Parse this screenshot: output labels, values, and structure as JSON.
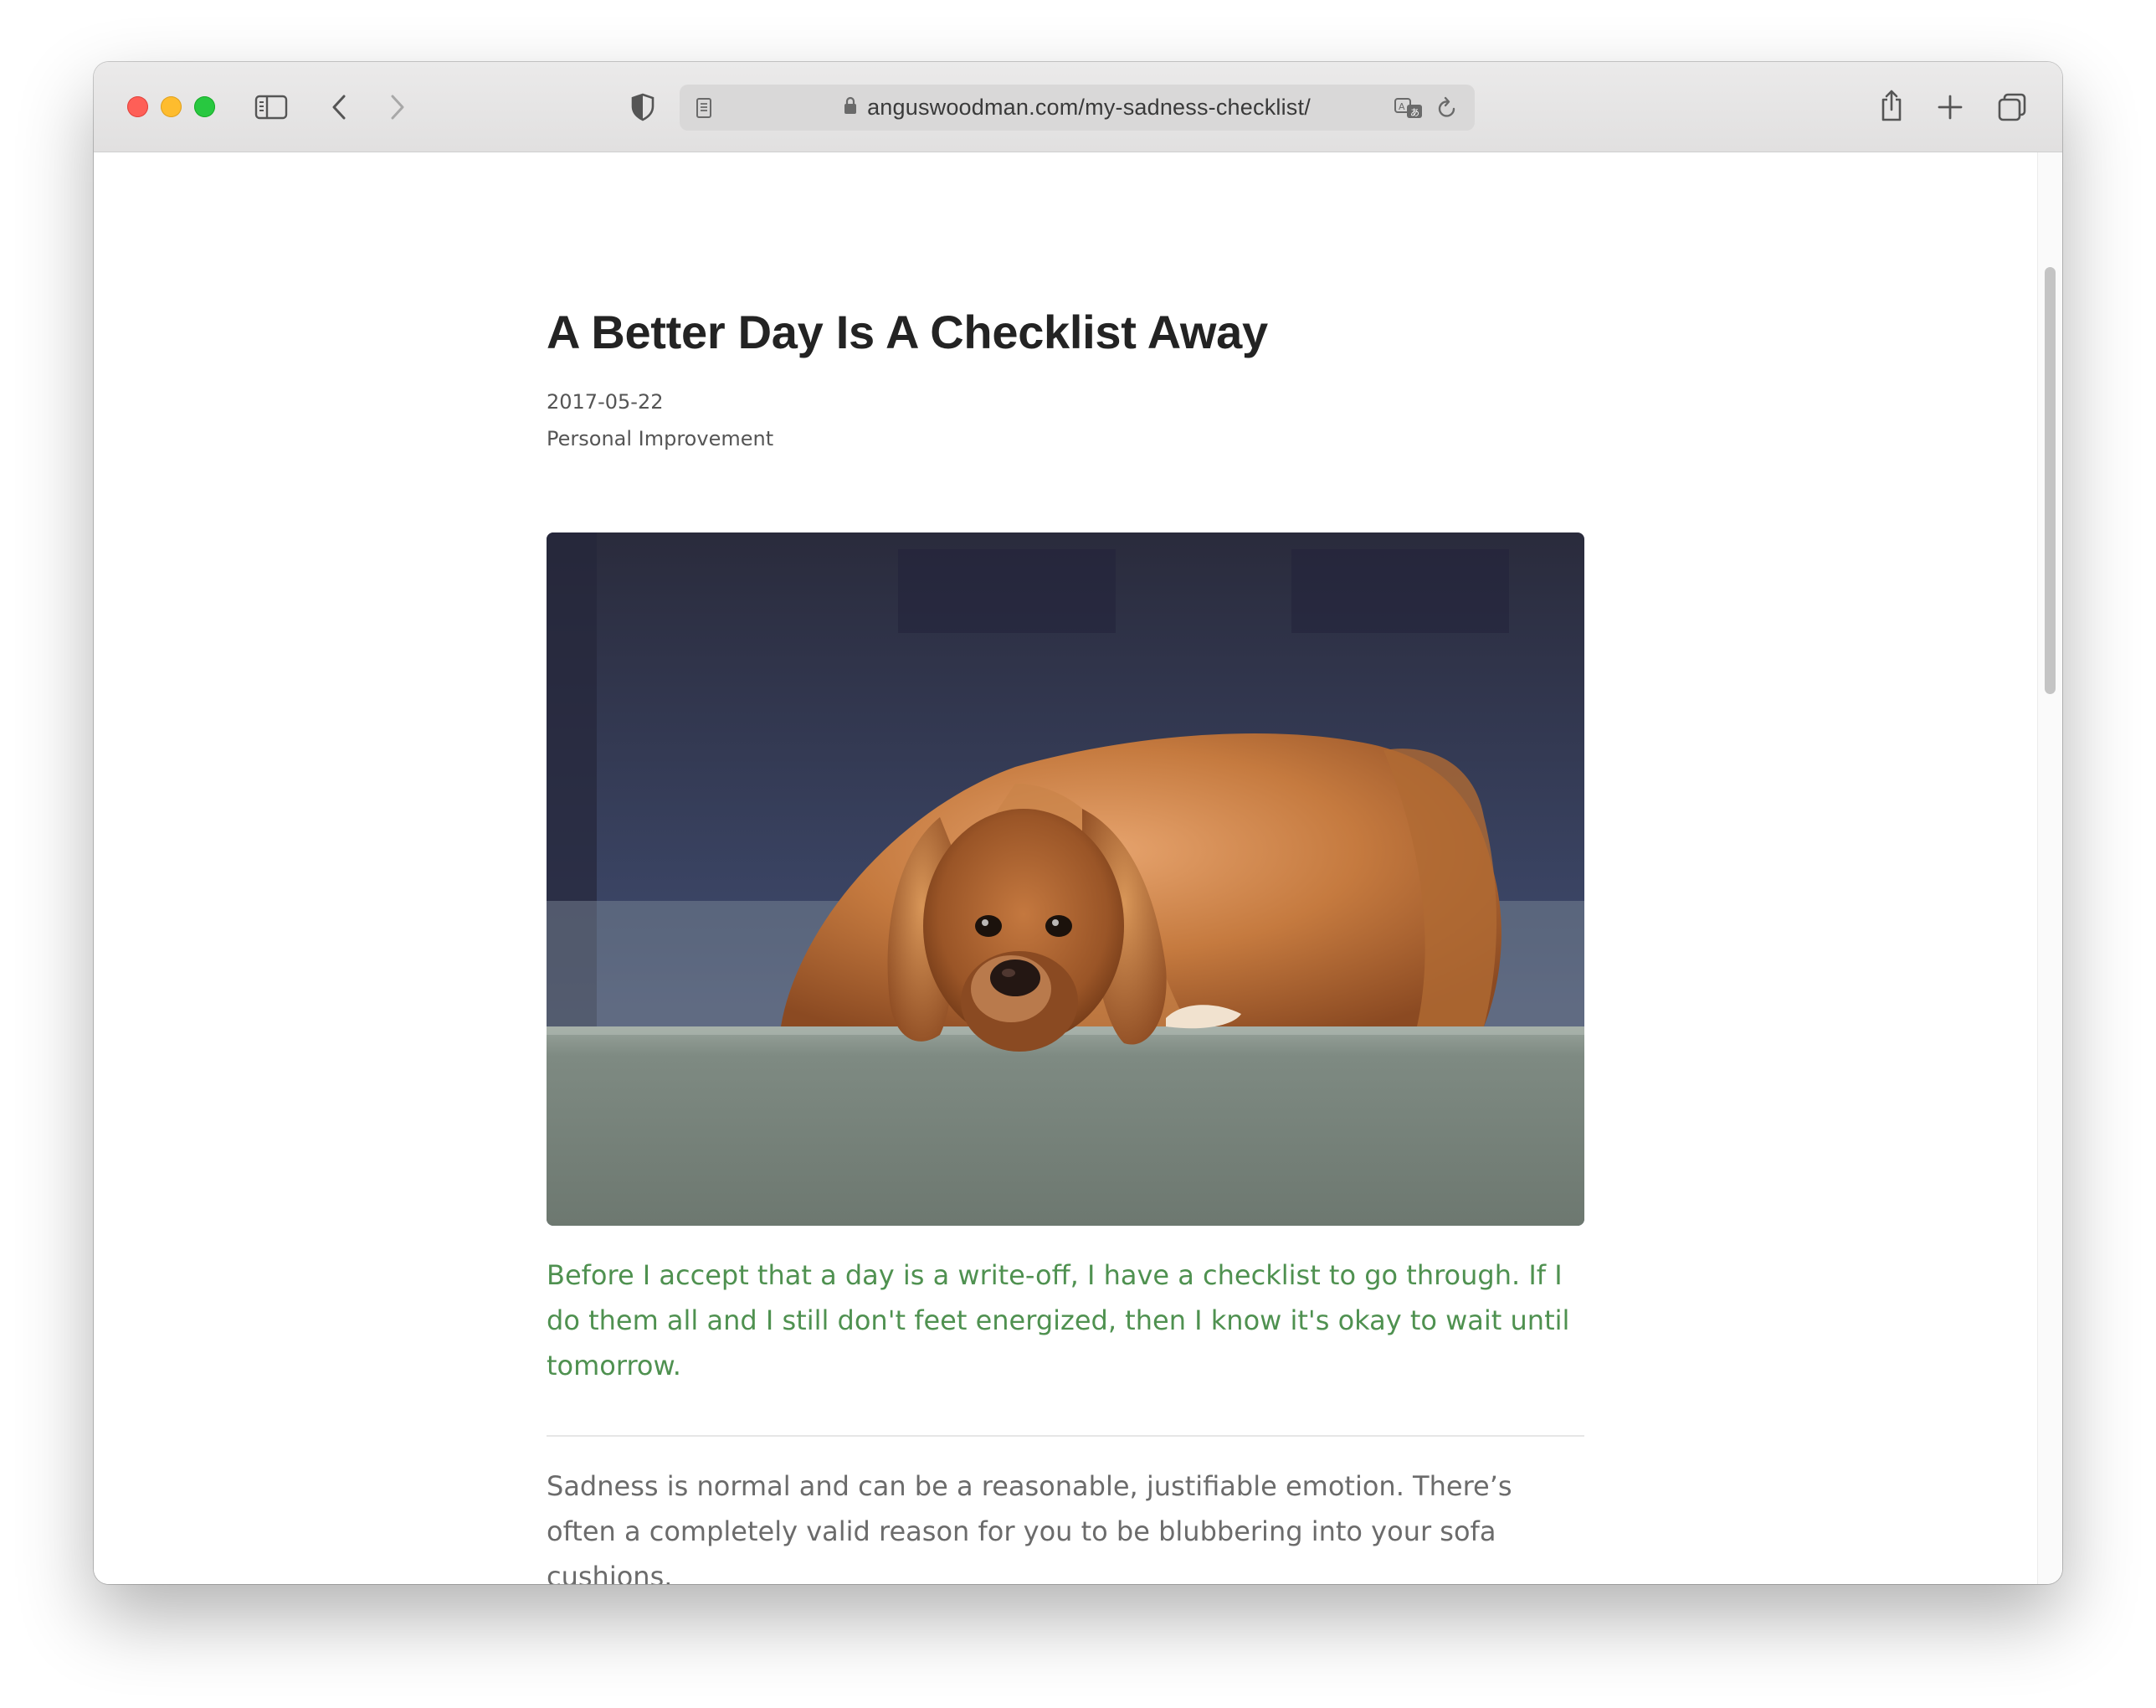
{
  "browser": {
    "url": "anguswoodman.com/my-sadness-checklist/"
  },
  "article": {
    "title": "A Better Day Is A Checklist Away",
    "date": "2017-05-22",
    "category": "Personal Improvement",
    "hero_image": "dog-lying-on-ledge-photo",
    "lead": "Before I accept that a day is a write-off, I have a checklist to go through. If I do them all and I still don't feet energized, then I know it's okay to wait until tomorrow.",
    "body": "Sadness is normal and can be a reasonable, justifiable emotion. There’s often a completely valid reason for you to be blubbering into your sofa cushions."
  },
  "colors": {
    "lead_text": "#4f9150",
    "body_text": "#6b6b6b",
    "title_text": "#232323"
  }
}
